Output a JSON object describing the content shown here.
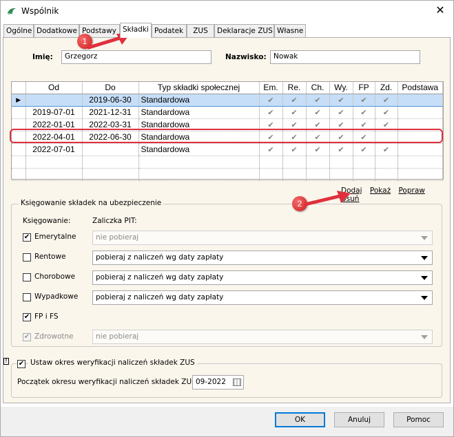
{
  "window": {
    "title": "Wspólnik",
    "close_glyph": "✕",
    "icon": "app-logo-icon"
  },
  "tabs": [
    {
      "label": "Ogólne"
    },
    {
      "label": "Dodatkowe"
    },
    {
      "label": "Podstawy"
    },
    {
      "label": "Składki",
      "active": true
    },
    {
      "label": "Podatek"
    },
    {
      "label": "ZUS"
    },
    {
      "label": "Deklaracje ZUS"
    },
    {
      "label": "Własne"
    }
  ],
  "person": {
    "first_name_label": "Imię:",
    "first_name_value": "Grzegorz",
    "last_name_label": "Nazwisko:",
    "last_name_value": "Nowak"
  },
  "grid": {
    "columns": [
      "",
      "Od",
      "Do",
      "Typ składki społecznej",
      "Em.",
      "Re.",
      "Ch.",
      "Wy.",
      "FP",
      "Zd.",
      "Podstawa"
    ],
    "check_glyph": "✔",
    "current_row_glyph": "▶",
    "rows": [
      {
        "od": "",
        "do": "2019-06-30",
        "typ": "Standardowa",
        "em": true,
        "re": true,
        "ch": true,
        "wy": true,
        "fp": true,
        "zd": true,
        "podstawa": "",
        "current": true
      },
      {
        "od": "2019-07-01",
        "do": "2021-12-31",
        "typ": "Standardowa",
        "em": true,
        "re": true,
        "ch": true,
        "wy": true,
        "fp": true,
        "zd": true,
        "podstawa": ""
      },
      {
        "od": "2022-01-01",
        "do": "2022-03-31",
        "typ": "Standardowa",
        "em": true,
        "re": true,
        "ch": true,
        "wy": true,
        "fp": true,
        "zd": true,
        "podstawa": ""
      },
      {
        "od": "2022-04-01",
        "do": "2022-06-30",
        "typ": "Standardowa",
        "em": true,
        "re": true,
        "ch": true,
        "wy": true,
        "fp": true,
        "zd": false,
        "podstawa": "",
        "highlighted": true
      },
      {
        "od": "2022-07-01",
        "do": "",
        "typ": "Standardowa",
        "em": true,
        "re": true,
        "ch": true,
        "wy": true,
        "fp": true,
        "zd": true,
        "podstawa": ""
      }
    ],
    "empty_rows": 2
  },
  "actions": {
    "add": "Dodaj",
    "show": "Pokaż",
    "edit": "Popraw",
    "delete": "Usuń"
  },
  "insurance_group": {
    "title": "Księgowanie składek na ubezpieczenie",
    "col1_header": "Księgowanie:",
    "col2_header": "Zaliczka PIT:",
    "items": [
      {
        "label": "Emerytalne",
        "checked": true,
        "disabled": false,
        "select_value": "nie pobieraj",
        "select_disabled": true
      },
      {
        "label": "Rentowe",
        "checked": false,
        "disabled": false,
        "select_value": "pobieraj z naliczeń wg daty zapłaty",
        "select_disabled": false
      },
      {
        "label": "Chorobowe",
        "checked": false,
        "disabled": false,
        "select_value": "pobieraj z naliczeń wg daty zapłaty",
        "select_disabled": false
      },
      {
        "label": "Wypadkowe",
        "checked": false,
        "disabled": false,
        "select_value": "pobieraj z naliczeń wg daty zapłaty",
        "select_disabled": false
      },
      {
        "label": "FP i FS",
        "checked": true,
        "disabled": false,
        "select_value": null
      },
      {
        "label": "Zdrowotne",
        "checked": true,
        "disabled": true,
        "select_value": "nie pobieraj",
        "select_disabled": true
      }
    ]
  },
  "verification_group": {
    "checkbox_label": "Ustaw okres weryfikacji naliczeń składek ZUS",
    "checked": true,
    "period_label": "Początek okresu weryfikacji naliczeń składek ZUS:",
    "period_value": "09-2022",
    "warn_glyph": "!"
  },
  "buttons": {
    "ok": "OK",
    "cancel": "Anuluj",
    "help": "Pomoc"
  },
  "annotations": {
    "badge1": "1",
    "badge2": "2",
    "color": "#e0303d"
  }
}
